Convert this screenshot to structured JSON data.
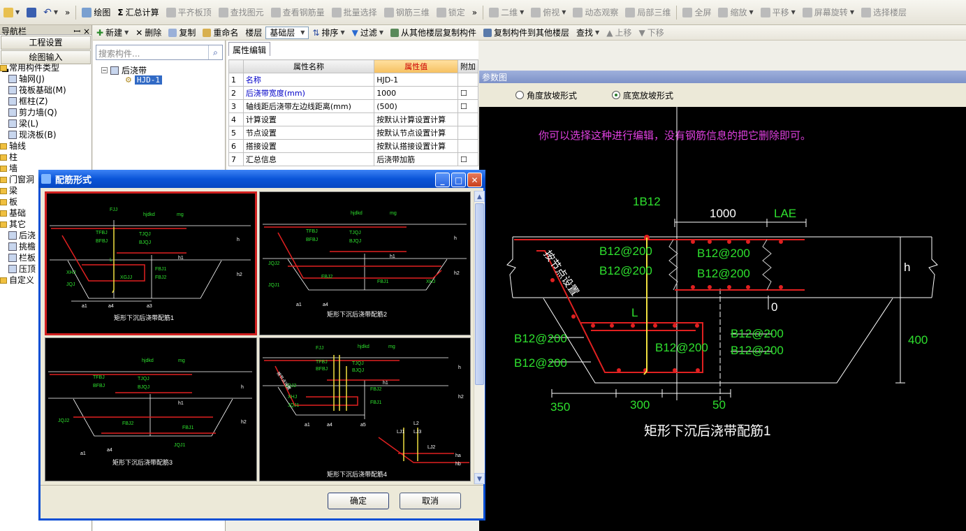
{
  "toolbar1": {
    "draw": "绘图",
    "sum": "汇总计算",
    "flat": "平齐板顶",
    "find_elem": "查找图元",
    "view_rebar": "查看钢筋量",
    "batch": "批量选择",
    "rebar3d": "钢筋三维",
    "lock": "锁定",
    "view2d": "二维",
    "top": "俯视",
    "orbit": "动态观察",
    "local3d": "局部三维",
    "fullscreen": "全屏",
    "zoom": "缩放",
    "pan": "平移",
    "rotate": "屏幕旋转",
    "select_floor": "选择楼层",
    "more": "»"
  },
  "toolbar2": {
    "new": "新建",
    "delete": "删除",
    "copy": "复制",
    "rename": "重命名",
    "floor_label": "楼层",
    "floor_value": "基础层",
    "sort": "排序",
    "filter": "过滤",
    "copy_from": "从其他楼层复制构件",
    "copy_to": "复制构件到其他楼层",
    "find": "查找",
    "up": "上移",
    "down": "下移"
  },
  "nav": {
    "title": "导航栏",
    "pin": "ꟷ",
    "close": "×",
    "btn1": "工程设置",
    "btn2": "绘图输入",
    "common": "常用构件类型",
    "items": [
      "轴网(J)",
      "筏板基础(M)",
      "框柱(Z)",
      "剪力墙(Q)",
      "梁(L)",
      "现浇板(B)"
    ],
    "groups": [
      "轴线",
      "柱",
      "墙",
      "门窗洞",
      "梁",
      "板",
      "基础",
      "其它"
    ],
    "sub": [
      "后浇",
      "挑檐",
      "栏板",
      "压顶"
    ],
    "custom": "自定义"
  },
  "mid": {
    "search_placeholder": "搜索构件...",
    "tree_root": "后浇带",
    "tree_child": "HJD-1"
  },
  "props": {
    "tab": "属性编辑",
    "col_name": "属性名称",
    "col_value": "属性值",
    "col_extra": "附加",
    "rows": [
      {
        "n": "1",
        "name": "名称",
        "value": "HJD-1",
        "blue": true
      },
      {
        "n": "2",
        "name": "后浇带宽度(mm)",
        "value": "1000",
        "blue": true
      },
      {
        "n": "3",
        "name": "轴线距后浇带左边线距离(mm)",
        "value": "(500)",
        "blue": false
      },
      {
        "n": "4",
        "name": "计算设置",
        "value": "按默认计算设置计算",
        "blue": false
      },
      {
        "n": "5",
        "name": "节点设置",
        "value": "按默认节点设置计算",
        "blue": false
      },
      {
        "n": "6",
        "name": "搭接设置",
        "value": "按默认搭接设置计算",
        "blue": false
      },
      {
        "n": "7",
        "name": "汇总信息",
        "value": "后浇带加筋",
        "blue": false
      }
    ]
  },
  "cad": {
    "header": "参数图",
    "radio1": "角度放坡形式",
    "radio2": "底宽放坡形式",
    "annotation": "你可以选择这种进行编辑，没有钢筋信息的把它删除即可。",
    "labels": {
      "top": "1B12",
      "w": "1000",
      "lae": "LAE",
      "h": "h",
      "zero": "0",
      "l": "L",
      "h400": "400",
      "b1": "B12@200",
      "b2": "B12@200",
      "b3": "B12@200",
      "b4": "B12@200",
      "b5": "B12@200",
      "b6": "B12@200",
      "b7": "B12@200",
      "b8": "B12@200",
      "b9": "B12@200",
      "d350": "350",
      "d300": "300",
      "d50": "50",
      "slope": "按节点设置"
    },
    "caption": "矩形下沉后浇带配筋1"
  },
  "dialog": {
    "title": "配筋形式",
    "captions": [
      "矩形下沉后浇带配筋1",
      "矩形下沉后浇带配筋2",
      "矩形下沉后浇带配筋3",
      "矩形下沉后浇带配筋4"
    ],
    "ok": "确定",
    "cancel": "取消",
    "thumb_labels": {
      "hjdkd": "hjdkd",
      "mg": "mg",
      "fjj": "FJJ",
      "tfbj": "TFBJ",
      "bfbj": "BFBJ",
      "tjqj": "TJQJ",
      "bjqj": "BJQJ",
      "h": "h",
      "h1": "h1",
      "h2": "h2",
      "l": "L",
      "xhj": "XHJ",
      "jqj": "JQJ",
      "jqj1": "JQJ1",
      "jqj2": "JQJ2",
      "fbj1": "FBJ1",
      "fbj2": "FBJ2",
      "xgjj": "XGJJ",
      "a1": "a1",
      "a4": "a4",
      "a3": "a3",
      "a5": "a5",
      "slope": "按节点设置",
      "l1": "LJ1",
      "l2": "LJ2",
      "l3": "LJ3",
      "l4": "L2",
      "ha": "ha",
      "hb": "hb"
    }
  }
}
